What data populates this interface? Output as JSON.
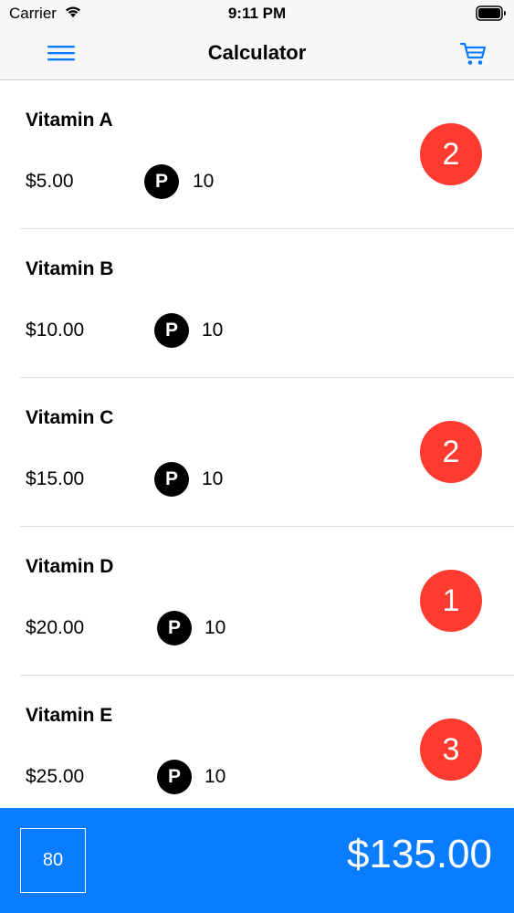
{
  "status_bar": {
    "carrier": "Carrier",
    "time": "9:11 PM"
  },
  "nav": {
    "title": "Calculator",
    "menu_icon": "hamburger-menu-icon",
    "cart_icon": "cart-icon"
  },
  "colors": {
    "accent": "#0a7cff",
    "badge": "#ff3b30"
  },
  "items": [
    {
      "name": "Vitamin A",
      "price": "$5.00",
      "points_icon": "P",
      "points": "10",
      "quantity": "2"
    },
    {
      "name": "Vitamin B",
      "price": "$10.00",
      "points_icon": "P",
      "points": "10",
      "quantity": ""
    },
    {
      "name": "Vitamin C",
      "price": "$15.00",
      "points_icon": "P",
      "points": "10",
      "quantity": "2"
    },
    {
      "name": "Vitamin D",
      "price": "$20.00",
      "points_icon": "P",
      "points": "10",
      "quantity": "1"
    },
    {
      "name": "Vitamin E",
      "price": "$25.00",
      "points_icon": "P",
      "points": "10",
      "quantity": "3"
    }
  ],
  "footer": {
    "points_total": "80",
    "total": "$135.00"
  }
}
